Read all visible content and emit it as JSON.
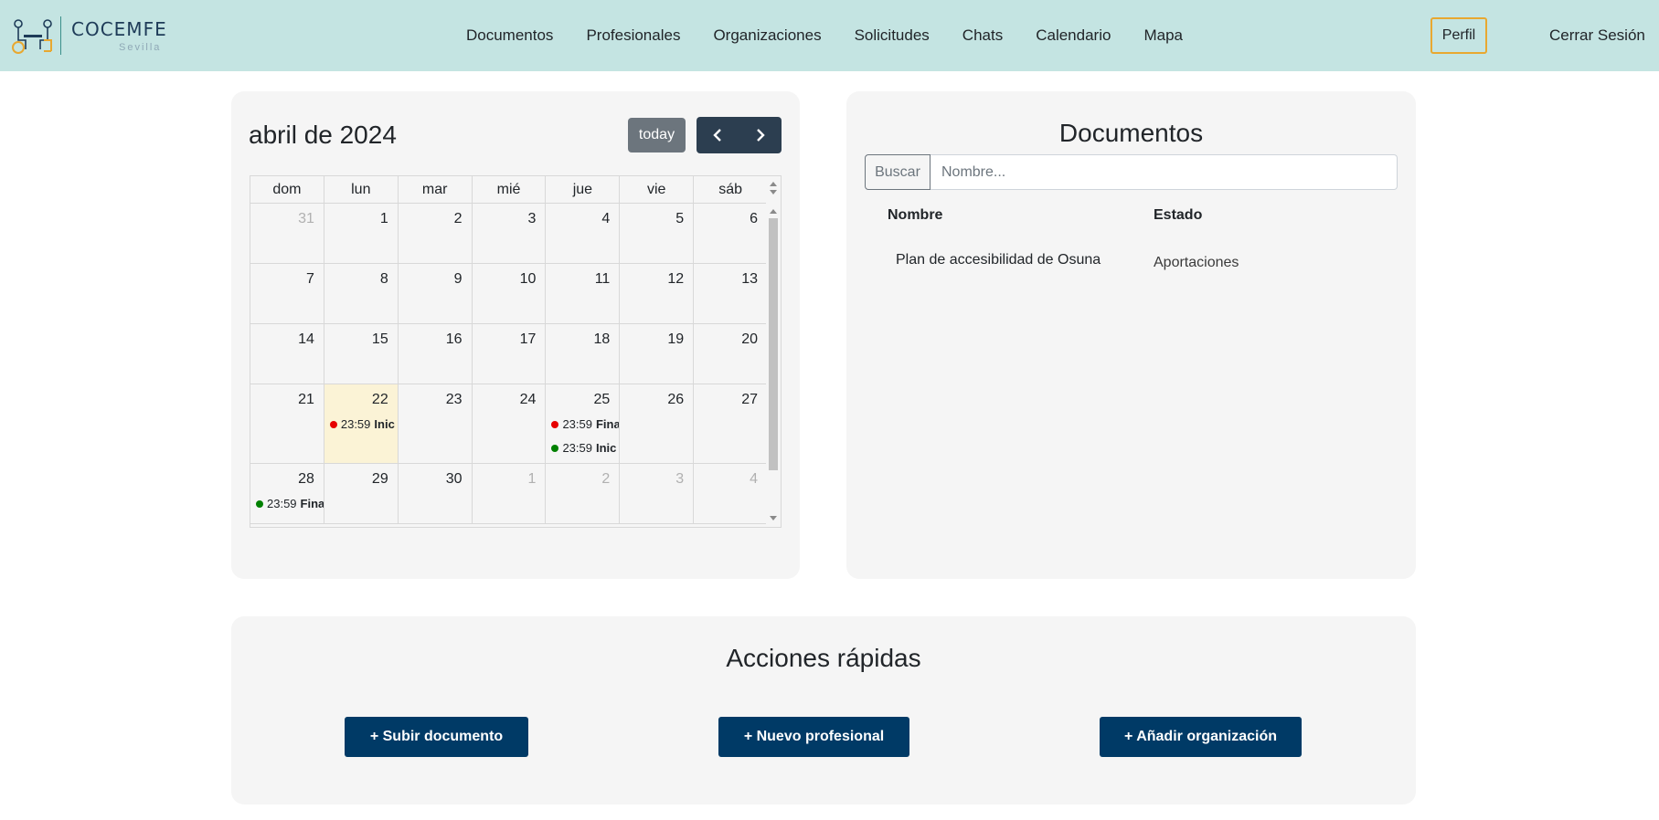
{
  "navbar": {
    "logo_text": "COCEMFE",
    "logo_sub": "Sevilla",
    "links": [
      "Documentos",
      "Profesionales",
      "Organizaciones",
      "Solicitudes",
      "Chats",
      "Calendario",
      "Mapa"
    ],
    "profile_label": "Perfil",
    "logout_label": "Cerrar Sesión",
    "accent": "#e8a830"
  },
  "calendar": {
    "title": "abril de 2024",
    "today_label": "today",
    "weekdays": [
      "dom",
      "lun",
      "mar",
      "mié",
      "jue",
      "vie",
      "sáb"
    ],
    "weeks": [
      [
        {
          "d": "31",
          "other": true
        },
        {
          "d": "1"
        },
        {
          "d": "2"
        },
        {
          "d": "3"
        },
        {
          "d": "4"
        },
        {
          "d": "5"
        },
        {
          "d": "6"
        }
      ],
      [
        {
          "d": "7"
        },
        {
          "d": "8"
        },
        {
          "d": "9"
        },
        {
          "d": "10"
        },
        {
          "d": "11"
        },
        {
          "d": "12"
        },
        {
          "d": "13"
        }
      ],
      [
        {
          "d": "14"
        },
        {
          "d": "15"
        },
        {
          "d": "16"
        },
        {
          "d": "17"
        },
        {
          "d": "18"
        },
        {
          "d": "19"
        },
        {
          "d": "20"
        }
      ],
      [
        {
          "d": "21"
        },
        {
          "d": "22",
          "today": true,
          "events": [
            {
              "time": "23:59",
              "title": "Inic",
              "color": "#e60000"
            }
          ]
        },
        {
          "d": "23"
        },
        {
          "d": "24"
        },
        {
          "d": "25",
          "events": [
            {
              "time": "23:59",
              "title": "Fina",
              "color": "#e60000"
            },
            {
              "time": "23:59",
              "title": "Inic",
              "color": "#008000"
            }
          ]
        },
        {
          "d": "26"
        },
        {
          "d": "27"
        }
      ],
      [
        {
          "d": "28",
          "events": [
            {
              "time": "23:59",
              "title": "Fina",
              "color": "#008000"
            }
          ]
        },
        {
          "d": "29"
        },
        {
          "d": "30"
        },
        {
          "d": "1",
          "other": true
        },
        {
          "d": "2",
          "other": true
        },
        {
          "d": "3",
          "other": true
        },
        {
          "d": "4",
          "other": true
        }
      ]
    ]
  },
  "documents": {
    "title": "Documentos",
    "search_button": "Buscar",
    "search_placeholder": "Nombre...",
    "columns": [
      "Nombre",
      "Estado"
    ],
    "rows": [
      {
        "name": "Plan de accesibilidad de Osuna",
        "status": "Aportaciones"
      }
    ]
  },
  "actions": {
    "title": "Acciones rápidas",
    "buttons": [
      "+ Subir documento",
      "+ Nuevo profesional",
      "+ Añadir organización"
    ],
    "button_color": "#003a66"
  }
}
